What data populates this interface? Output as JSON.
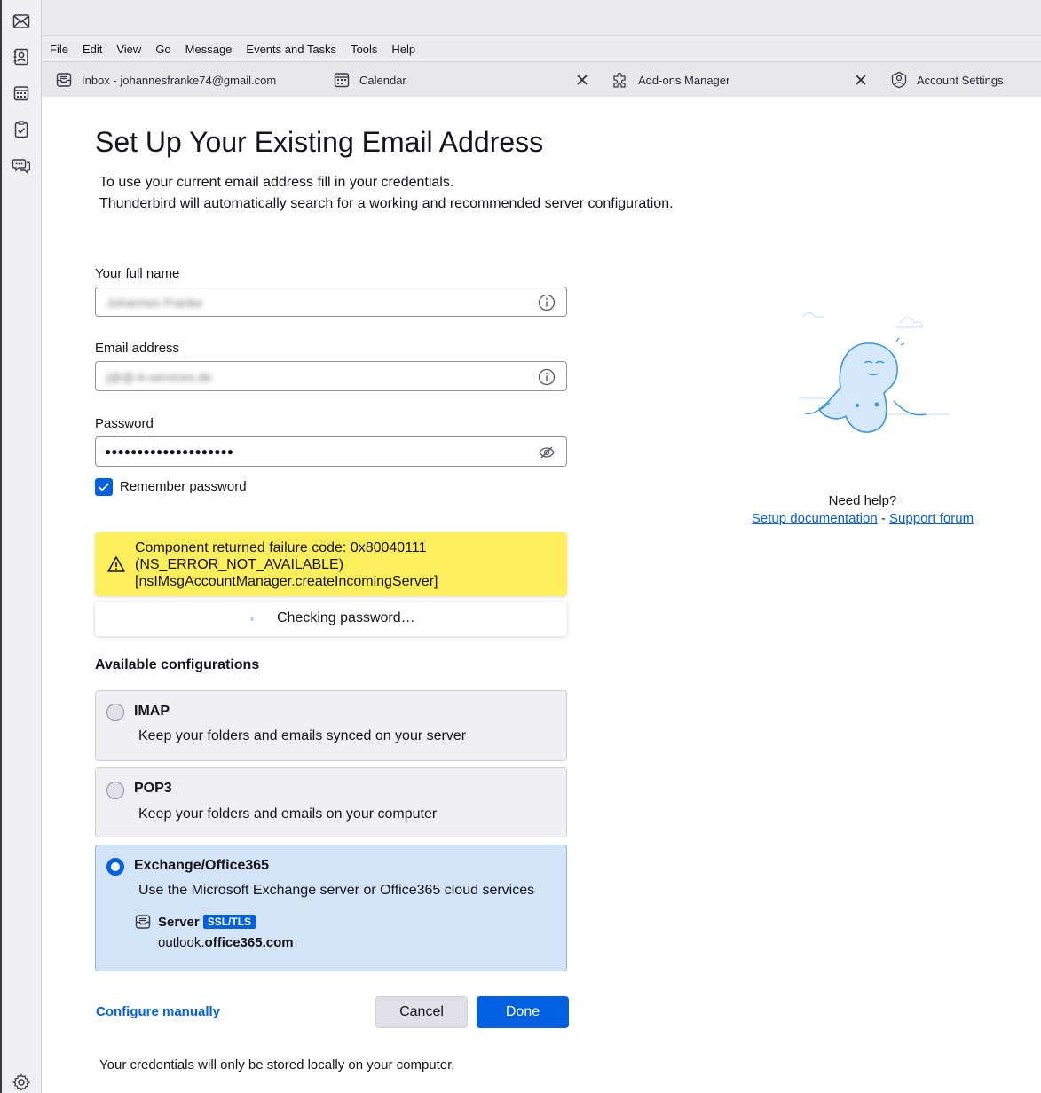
{
  "menubar": {
    "items": [
      "File",
      "Edit",
      "View",
      "Go",
      "Message",
      "Events and Tasks",
      "Tools",
      "Help"
    ]
  },
  "spaces": {
    "icons": [
      "mail-icon",
      "address-book-icon",
      "calendar-icon",
      "tasks-icon",
      "chat-icon",
      "settings-icon"
    ]
  },
  "tabs": [
    {
      "label": "Inbox - johannesfranke74@gmail.com",
      "icon": "inbox-icon"
    },
    {
      "label": "Calendar",
      "icon": "calendar-icon"
    },
    {
      "label": "Add-ons Manager",
      "icon": "puzzle-icon"
    },
    {
      "label": "Account Settings",
      "icon": "account-icon"
    }
  ],
  "page": {
    "title": "Set Up Your Existing Email Address",
    "intro_line1": "To use your current email address fill in your credentials.",
    "intro_line2": "Thunderbird will automatically search for a working and recommended server configuration."
  },
  "form": {
    "name_label": "Your full name",
    "name_value": "Johannes Franke",
    "email_label": "Email address",
    "email_value": "j@@-k-services.de",
    "password_label": "Password",
    "password_value": "●●●●●●●●●●●●●●●●●●●●",
    "remember_label": "Remember password",
    "remember_checked": true
  },
  "warning": {
    "line1": "Component returned failure code: 0x80040111",
    "line2": "(NS_ERROR_NOT_AVAILABLE)",
    "line3": "[nsIMsgAccountManager.createIncomingServer]"
  },
  "status": {
    "text": "Checking password…"
  },
  "configs": {
    "title": "Available configurations",
    "imap": {
      "name": "IMAP",
      "desc": "Keep your folders and emails synced on your server"
    },
    "pop3": {
      "name": "POP3",
      "desc": "Keep your folders and emails on your computer"
    },
    "exchange": {
      "name": "Exchange/Office365",
      "desc": "Use the Microsoft Exchange server or Office365 cloud services",
      "server_label": "Server",
      "ssl_badge": "SSL/TLS",
      "host_prefix": "outlook.",
      "host_domain": "office365.com"
    },
    "selected": "exchange"
  },
  "actions": {
    "configure_manually": "Configure manually",
    "cancel": "Cancel",
    "done": "Done"
  },
  "footer": {
    "note": "Your credentials will only be stored locally on your computer."
  },
  "help": {
    "title": "Need help?",
    "setup_doc": "Setup documentation",
    "separator": "-",
    "support_forum": "Support forum"
  },
  "colors": {
    "accent": "#0061e0",
    "warning_bg": "#ffef5c",
    "selected_bg": "#d3e4f8"
  }
}
